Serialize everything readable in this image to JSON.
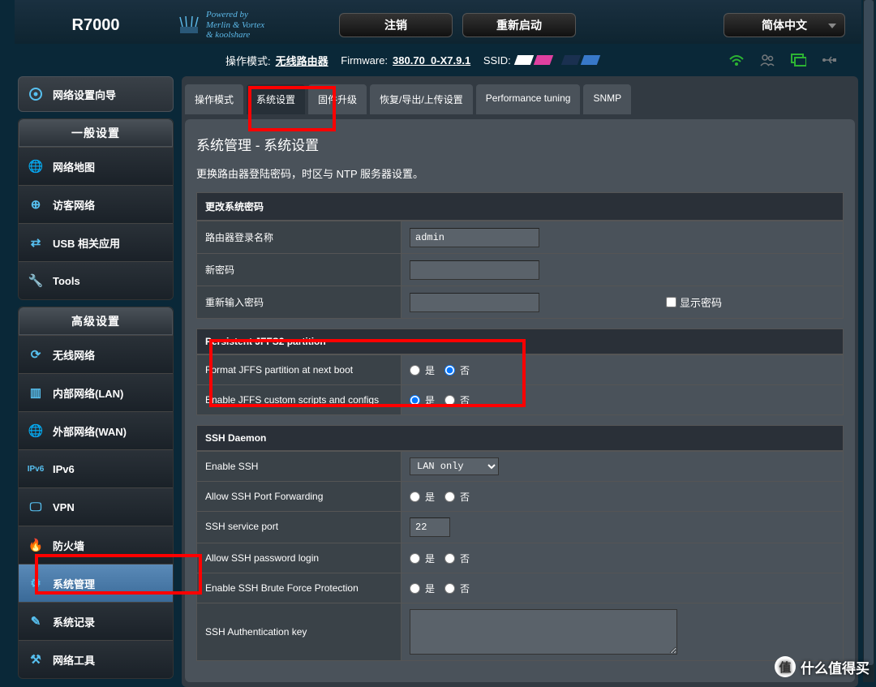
{
  "header": {
    "model": "R7000",
    "powered1": "Powered by",
    "powered2": "Merlin & Vortex",
    "powered3": "& koolshare",
    "logout": "注销",
    "reboot": "重新启动",
    "lang": "简体中文"
  },
  "infobar": {
    "mode_label": "操作模式:",
    "mode_value": "无线路由器",
    "fw_label": "Firmware:",
    "fw_value": "380.70_0-X7.9.1",
    "ssid_label": "SSID:"
  },
  "sidebar": {
    "wizard": "网络设置向导",
    "group1_head": "一般设置",
    "group1": [
      {
        "icon": "globe",
        "label": "网络地图"
      },
      {
        "icon": "guest",
        "label": "访客网络"
      },
      {
        "icon": "usb",
        "label": "USB 相关应用"
      },
      {
        "icon": "tools",
        "label": "Tools"
      }
    ],
    "group2_head": "高级设置",
    "group2": [
      {
        "icon": "wifi",
        "label": "无线网络"
      },
      {
        "icon": "lan",
        "label": "内部网络(LAN)"
      },
      {
        "icon": "wan",
        "label": "外部网络(WAN)"
      },
      {
        "icon": "ipv6",
        "label": "IPv6"
      },
      {
        "icon": "vpn",
        "label": "VPN"
      },
      {
        "icon": "fire",
        "label": "防火墙"
      },
      {
        "icon": "admin",
        "label": "系统管理"
      },
      {
        "icon": "log",
        "label": "系统记录"
      },
      {
        "icon": "tool",
        "label": "网络工具"
      }
    ]
  },
  "tabs": [
    "操作模式",
    "系统设置",
    "固件升级",
    "恢复/导出/上传设置",
    "Performance tuning",
    "SNMP"
  ],
  "panel": {
    "title": "系统管理 - 系统设置",
    "desc": "更换路由器登陆密码，时区与 NTP 服务器设置。"
  },
  "sec_password": {
    "head": "更改系统密码",
    "login_name": "路由器登录名称",
    "login_value": "admin",
    "newpw": "新密码",
    "confirmpw": "重新输入密码",
    "showpw": "显示密码"
  },
  "sec_jffs": {
    "head": "Persistent JFFS2 partition",
    "format": "Format JFFS partition at next boot",
    "enable": "Enable JFFS custom scripts and configs"
  },
  "sec_ssh": {
    "head": "SSH Daemon",
    "enable": "Enable SSH",
    "enable_value": "LAN only",
    "portfwd": "Allow SSH Port Forwarding",
    "port": "SSH service port",
    "port_value": "22",
    "pwlogin": "Allow SSH password login",
    "brute": "Enable SSH Brute Force Protection",
    "authkey": "SSH Authentication key"
  },
  "opt": {
    "yes": "是",
    "no": "否"
  },
  "watermark": "什么值得买"
}
